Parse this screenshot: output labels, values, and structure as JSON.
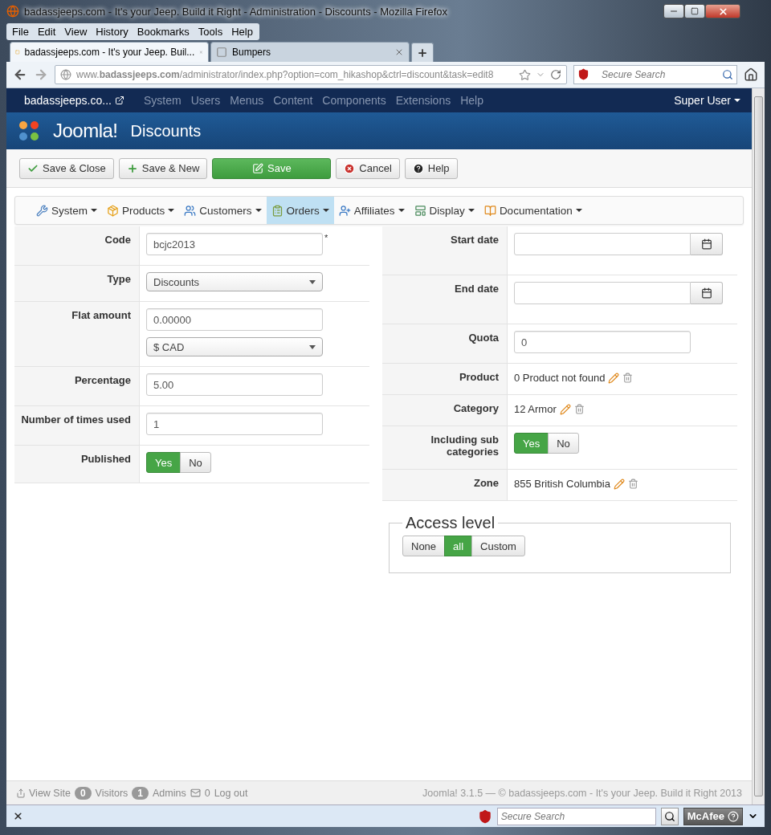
{
  "browser": {
    "title": "badassjeeps.com - It's your Jeep. Build it Right - Administration - Discounts - Mozilla Firefox",
    "menu": [
      "File",
      "Edit",
      "View",
      "History",
      "Bookmarks",
      "Tools",
      "Help"
    ],
    "tabs": [
      {
        "label": "badassjeeps.com - It's your Jeep. Buil...",
        "selected": true
      },
      {
        "label": "Bumpers",
        "selected": false
      }
    ],
    "url": "www.**badassjeeps.com**/administrator/index.php?option=com_hikashop&ctrl=discount&task=edit8",
    "search_placeholder": "Secure Search"
  },
  "admin": {
    "site": "badassjeeps.co...",
    "nav": [
      "System",
      "Users",
      "Menus",
      "Content",
      "Components",
      "Extensions",
      "Help"
    ],
    "user": "Super User",
    "logo": "Joomla!",
    "page_title": "Discounts"
  },
  "toolbar": [
    {
      "label": "Save & Close",
      "kind": "check"
    },
    {
      "label": "Save & New",
      "kind": "new"
    },
    {
      "label": "Save",
      "kind": "primary"
    },
    {
      "label": "Cancel",
      "kind": "cancel"
    },
    {
      "label": "Help",
      "kind": "help"
    }
  ],
  "submenu": [
    {
      "label": "System",
      "kind": "system",
      "selected": false
    },
    {
      "label": "Products",
      "kind": "products",
      "selected": false
    },
    {
      "label": "Customers",
      "kind": "customers",
      "selected": false
    },
    {
      "label": "Orders",
      "kind": "orders",
      "selected": true
    },
    {
      "label": "Affiliates",
      "kind": "affiliates",
      "selected": false
    },
    {
      "label": "Display",
      "kind": "display",
      "selected": false
    },
    {
      "label": "Documentation",
      "kind": "documentation",
      "selected": false
    }
  ],
  "left_rows": [
    {
      "label": "Code",
      "fields": [
        {
          "kind": "text",
          "value": "bcjc2013",
          "required_mark": "*"
        }
      ]
    },
    {
      "label": "Type",
      "fields": [
        {
          "kind": "select",
          "value": "Discounts"
        }
      ]
    },
    {
      "label": "Flat amount",
      "fields": [
        {
          "kind": "text",
          "value": "0.00000"
        },
        {
          "kind": "select",
          "value": "$ CAD"
        }
      ]
    },
    {
      "label": "Percentage",
      "fields": [
        {
          "kind": "text",
          "value": "5.00"
        }
      ]
    },
    {
      "label": "Number of times used",
      "fields": [
        {
          "kind": "text",
          "value": "1"
        }
      ]
    },
    {
      "label": "Published",
      "fields": [
        {
          "kind": "toggle",
          "options": [
            {
              "label": "Yes",
              "selected": true
            },
            {
              "label": "No",
              "selected": false
            }
          ]
        }
      ]
    }
  ],
  "right_rows": [
    {
      "label": "Start date",
      "fields": [
        {
          "kind": "date"
        }
      ]
    },
    {
      "label": "End date",
      "fields": [
        {
          "kind": "date"
        }
      ]
    },
    {
      "label": "Quota",
      "fields": [
        {
          "kind": "text",
          "value": "0"
        }
      ]
    },
    {
      "label": "Product",
      "fields": [
        {
          "kind": "link",
          "value": "0 Product not found"
        }
      ]
    },
    {
      "label": "Category",
      "fields": [
        {
          "kind": "link",
          "value": "12 Armor"
        }
      ]
    },
    {
      "label": "Including sub categories",
      "fields": [
        {
          "kind": "toggle",
          "options": [
            {
              "label": "Yes",
              "selected": true
            },
            {
              "label": "No",
              "selected": false
            }
          ]
        }
      ]
    },
    {
      "label": "Zone",
      "fields": [
        {
          "kind": "link",
          "value": "855 British Columbia"
        }
      ]
    }
  ],
  "access_level": {
    "legend": "Access level",
    "options": [
      {
        "label": "None",
        "selected": false
      },
      {
        "label": "all",
        "selected": true
      },
      {
        "label": "Custom",
        "selected": false
      }
    ]
  },
  "footer": {
    "view_site": "View Site",
    "visitors_count": "0",
    "visitors": "Visitors",
    "admins_count": "1",
    "admins": "Admins",
    "messages_count": "0",
    "logout": "Log out",
    "copyright": "Joomla! 3.1.5 — © badassjeeps.com - It's your Jeep. Build it Right 2013"
  },
  "addon_bar": {
    "search_placeholder": "Secure Search",
    "brand": "McAfee"
  }
}
